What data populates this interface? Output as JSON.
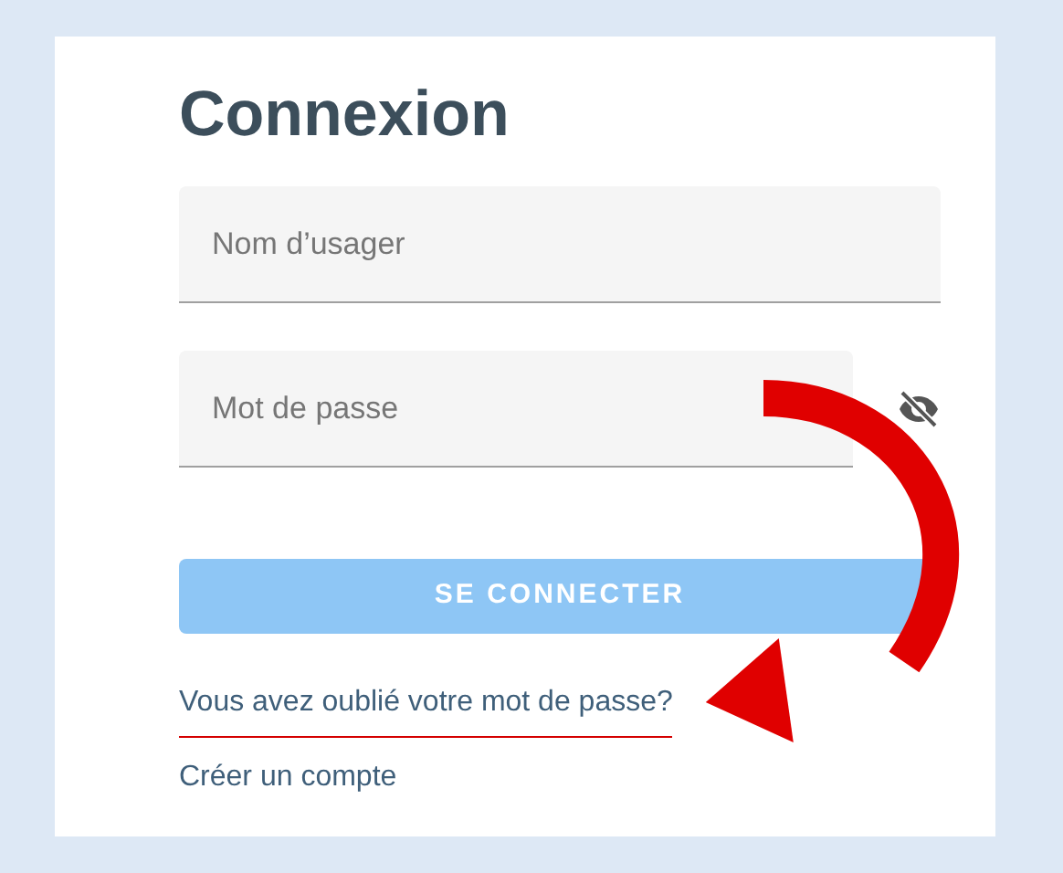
{
  "title": "Connexion",
  "fields": [
    {
      "placeholder": "Nom d’usager",
      "kind": "text"
    },
    {
      "placeholder": "Mot de passe",
      "kind": "password"
    }
  ],
  "submit": {
    "label": "SE CONNECTER",
    "disabled": true
  },
  "links": [
    {
      "label": "Vous avez oublié votre mot de passe?",
      "highlighted": true
    },
    {
      "label": "Créer un compte",
      "highlighted": false
    }
  ]
}
